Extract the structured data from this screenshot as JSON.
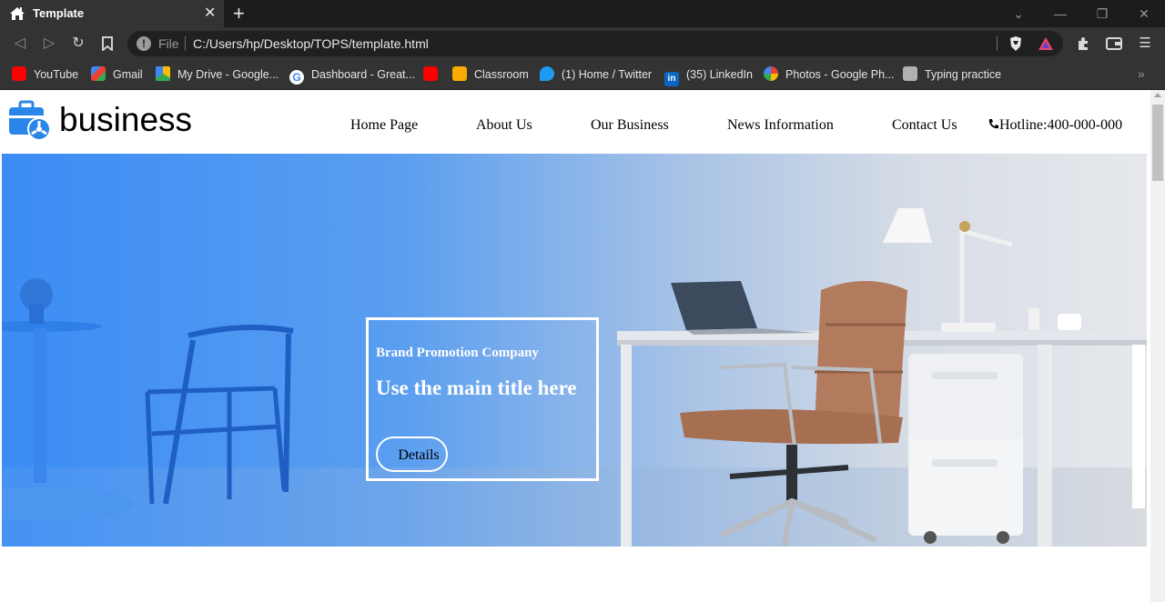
{
  "browser": {
    "tab_title": "Template",
    "tab_close": "✕",
    "new_tab": "+",
    "omnibox": {
      "scheme_label": "File",
      "url": "C:/Users/hp/Desktop/TOPS/template.html"
    },
    "bookmarks": [
      {
        "label": "YouTube",
        "icon": "youtube-icon",
        "color": "#ff0000"
      },
      {
        "label": "Gmail",
        "icon": "gmail-icon",
        "color": "#ea4335"
      },
      {
        "label": "My Drive - Google...",
        "icon": "google-drive-icon",
        "color": "#fbbc04"
      },
      {
        "label": "Dashboard - Great...",
        "icon": "google-icon",
        "color": "#ffffff"
      },
      {
        "label": "",
        "icon": "youtube-icon",
        "color": "#ff0000"
      },
      {
        "label": "Classroom",
        "icon": "classroom-icon",
        "color": "#f9ab00"
      },
      {
        "label": "(1) Home / Twitter",
        "icon": "twitter-icon",
        "color": "#1d9bf0"
      },
      {
        "label": "(35) LinkedIn",
        "icon": "linkedin-icon",
        "color": "#0a66c2"
      },
      {
        "label": "Photos - Google Ph...",
        "icon": "google-photos-icon",
        "color": "#34a853"
      },
      {
        "label": "Typing practice",
        "icon": "typing-icon",
        "color": "#b0b0b0"
      }
    ],
    "more_bookmarks": "»"
  },
  "site": {
    "logo_text": "business",
    "nav": [
      "Home Page",
      "About Us",
      "Our Business",
      "News Information",
      "Contact Us"
    ],
    "hotline": "Hotline:400-000-000",
    "hero": {
      "subtitle": "Brand Promotion Company",
      "title": "Use the main title here",
      "button": "Details"
    }
  },
  "colors": {
    "accent_blue": "#3b8cf5",
    "chrome_dark": "#1c1c1c",
    "chrome_mid": "#333333"
  }
}
